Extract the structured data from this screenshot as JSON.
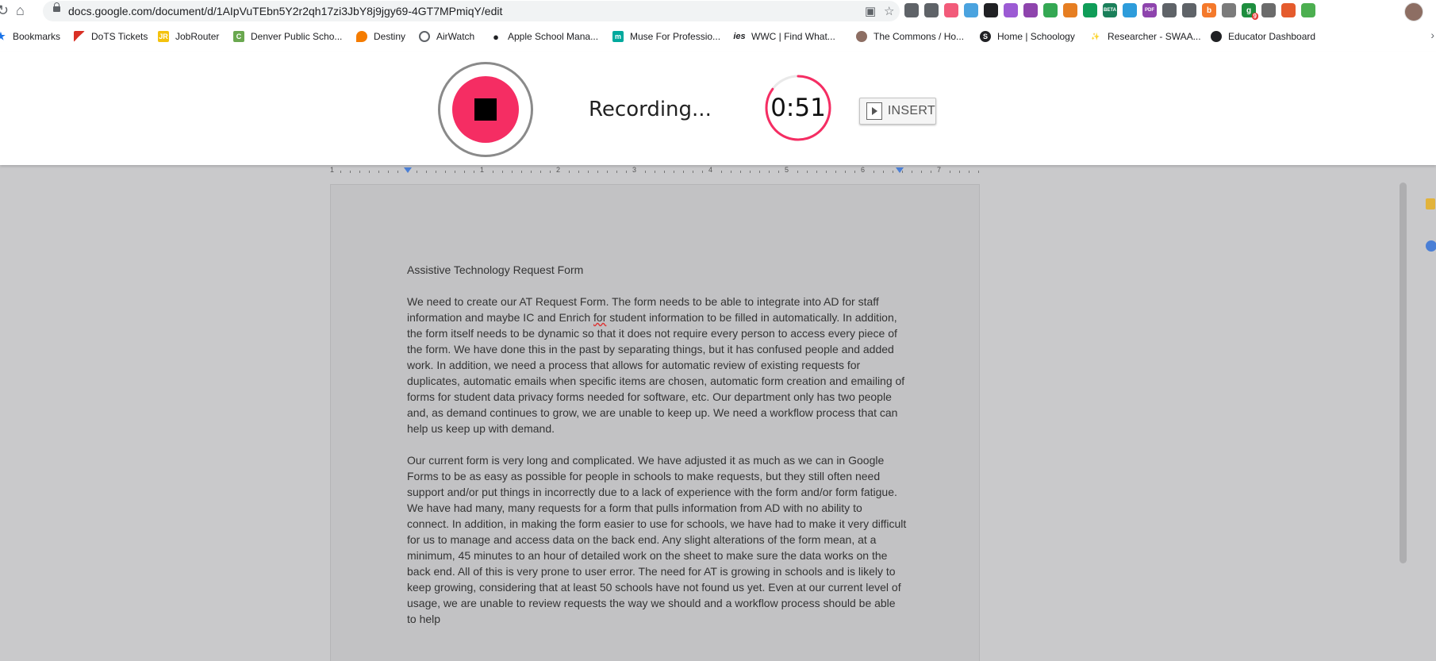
{
  "browser": {
    "url": "docs.google.com/document/d/1AIpVuTEbn5Y2r2qh17zi3JbY8j9jgy69-4GT7MPmiqY/edit",
    "extensions": [
      {
        "icon": "camera-icon",
        "color": "#5f6368",
        "text": ""
      },
      {
        "icon": "star-icon",
        "color": "#5f6368",
        "text": ""
      },
      {
        "icon": "arrow-extension-icon",
        "color": "#f25b7a",
        "text": ""
      },
      {
        "icon": "cloud-extension-icon",
        "color": "#4aa3df",
        "text": ""
      },
      {
        "icon": "layers-extension-icon",
        "color": "#202124",
        "text": ""
      },
      {
        "icon": "chat-extension-icon",
        "color": "#9c5bd4",
        "text": ""
      },
      {
        "icon": "puzzle-extension-icon",
        "color": "#8e44ad",
        "text": ""
      },
      {
        "icon": "drive-extension-icon",
        "color": "#34a853",
        "text": ""
      },
      {
        "icon": "colorful-extension-icon",
        "color": "#e67e22",
        "text": ""
      },
      {
        "icon": "sheets-extension-icon",
        "color": "#0f9d58",
        "text": ""
      },
      {
        "icon": "beta-extension-icon",
        "color": "#1a7f5a",
        "text": "BETA"
      },
      {
        "icon": "diamond-extension-icon",
        "color": "#2d9cdb",
        "text": ""
      },
      {
        "icon": "pdf-extension-icon",
        "color": "#8e44ad",
        "text": "PDF"
      },
      {
        "icon": "circle-extension-icon",
        "color": "#5f6368",
        "text": ""
      },
      {
        "icon": "shield-extension-icon",
        "color": "#5f6368",
        "text": ""
      },
      {
        "icon": "b-extension-icon",
        "color": "#f4792b",
        "text": "b"
      },
      {
        "icon": "robot-extension-icon",
        "color": "#7b7b7b",
        "text": ""
      },
      {
        "icon": "g-extension-icon",
        "color": "#1e8e3e",
        "text": "g",
        "badge": "9"
      },
      {
        "icon": "bulb-extension-icon",
        "color": "#6b6b6b",
        "text": ""
      },
      {
        "icon": "toggle-extension-icon",
        "color": "#e55b2d",
        "text": ""
      },
      {
        "icon": "check-extension-icon",
        "color": "#4caf50",
        "text": ""
      }
    ]
  },
  "bookmarks": [
    {
      "label": "Bookmarks",
      "icon": "star-icon",
      "color": "#1a73e8"
    },
    {
      "label": "DoTS Tickets",
      "icon": "flag-icon",
      "color": "#d93025"
    },
    {
      "label": "JobRouter",
      "icon": "jr-icon",
      "color": "#f4c20d"
    },
    {
      "label": "Denver Public Scho...",
      "icon": "c-icon",
      "color": "#6aa84f"
    },
    {
      "label": "Destiny",
      "icon": "destiny-icon",
      "color": "#f57c00"
    },
    {
      "label": "AirWatch",
      "icon": "airwatch-icon",
      "color": "#5f6368"
    },
    {
      "label": "Apple School Mana...",
      "icon": "apple-icon",
      "color": "#202124"
    },
    {
      "label": "Muse For Professio...",
      "icon": "m-icon",
      "color": "#00a99d"
    },
    {
      "label": "WWC | Find What...",
      "icon": "ies-icon",
      "color": "#202124"
    },
    {
      "label": "The Commons / Ho...",
      "icon": "commons-icon",
      "color": "#8d6e63"
    },
    {
      "label": "Home | Schoology",
      "icon": "schoology-icon",
      "color": "#202124"
    },
    {
      "label": "Researcher - SWAA...",
      "icon": "researcher-icon",
      "color": "#f4c20d"
    },
    {
      "label": "Educator Dashboard",
      "icon": "dashboard-icon",
      "color": "#202124"
    }
  ],
  "recorder": {
    "status": "Recording...",
    "timer": "0:51",
    "timer_progress": 0.85,
    "insert_label": "INSERT",
    "accent": "#f52d63"
  },
  "ruler": {
    "numbers": [
      "1",
      "1",
      "2",
      "3",
      "4",
      "5",
      "6",
      "7"
    ]
  },
  "document": {
    "title": "Assistive Technology Request Form",
    "p1_a": "We need to create our AT Request Form. The form needs to be able to integrate into AD for staff information and maybe IC and Enrich ",
    "p1_spell": "for",
    "p1_b": " student information to be filled in automatically. In addition, the form itself needs to be dynamic so that it does not require every person to access every piece of the form. We have done this in the past by separating things, but it has confused people and added work. In addition, we need a process that allows for automatic review of existing requests for duplicates, automatic emails when specific items are chosen, automatic form creation and emailing of forms for student data privacy forms needed for software, etc. Our department only has two people and, as demand continues to grow, we are unable to keep up. We need a workflow process that can help us keep up with demand.",
    "p2": "Our current form is very long and complicated. We have adjusted it as much as we can in Google Forms to be as easy as possible for people in schools to make requests, but they still often need support and/or put things in incorrectly due to a lack of experience with the form and/or form fatigue. We have had many, many requests for a form that pulls information from AD with no ability to connect. In addition, in making the form easier to use for schools, we have had to make it very difficult for us to manage and access data on the back end. Any slight alterations of the form mean, at a minimum, 45 minutes to an hour of detailed work on the sheet to make sure the data works on the back end. All of this is very prone to user error. The need for AT is growing in schools and is likely to keep growing, considering that at least 50 schools have not found us yet. Even at our current level of usage, we are unable to review requests the way we should and a workflow process should be able to help"
  }
}
